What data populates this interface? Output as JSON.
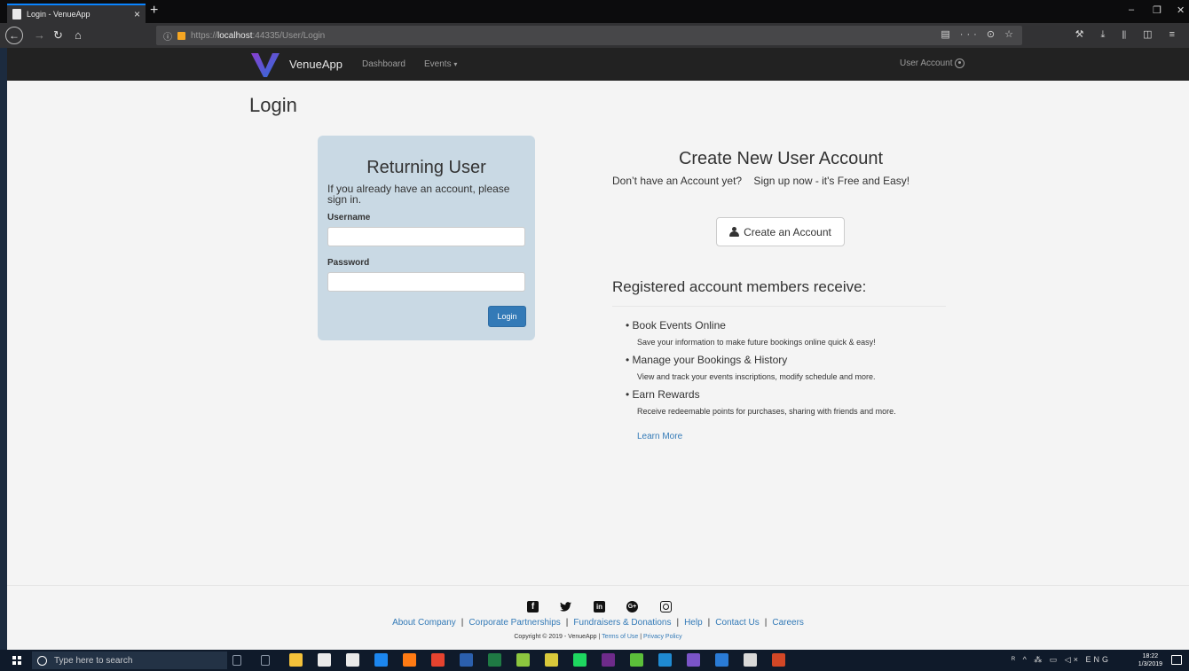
{
  "browser": {
    "tab_title": "Login - VenueApp",
    "tab_close": "×",
    "new_tab": "+",
    "url_info": "ⓘ",
    "url_scheme": "https://",
    "url_host": "localhost",
    "url_rest": ":44335/User/Login",
    "url_actions": "▤ ··· ⊙ ☆",
    "toolbar_icons": "⚒ ⤓ ⫴ ◫ ≡",
    "window_min": "–",
    "window_restore": "❐",
    "window_close": "✕",
    "back": "←",
    "forward": "→",
    "reload": "↻",
    "home": "⌂"
  },
  "site": {
    "brand": "VenueApp",
    "nav": [
      {
        "label": "Dashboard"
      },
      {
        "label": "Events"
      }
    ],
    "events_caret": "▾",
    "account_label": "User Account",
    "brand_colors": {
      "logo_start": "#7b3fd1",
      "logo_end": "#2a6fd8",
      "link": "#337ab7",
      "primary_button": "#337ab7",
      "panel_bg": "#c9d9e4"
    }
  },
  "page_title": "Login",
  "login": {
    "heading": "Returning User",
    "intro": "If you already have an account, please sign in.",
    "username_label": "Username",
    "username_value": "",
    "password_label": "Password",
    "password_value": "",
    "submit_label": "Login"
  },
  "register": {
    "heading": "Create New User Account",
    "subtext": "Don’t have an Account yet?    Sign up now - it's Free and Easy!",
    "button_label": "Create an Account",
    "benefits_heading": "Registered account members receive:",
    "benefits": [
      {
        "title": "• Book Events Online",
        "desc": "Save your information to make future bookings online quick & easy!"
      },
      {
        "title": "• Manage your Bookings & History",
        "desc": "View and track your events inscriptions, modify schedule and more."
      },
      {
        "title": "• Earn Rewards",
        "desc": "Receive redeemable points for purchases, sharing with friends and more."
      }
    ],
    "learn_more": "Learn More"
  },
  "footer": {
    "social": [
      {
        "name": "facebook-icon",
        "glyph": "f"
      },
      {
        "name": "twitter-icon",
        "glyph": "🐦"
      },
      {
        "name": "linkedin-icon",
        "glyph": "in"
      },
      {
        "name": "google-plus-icon",
        "glyph": "G+"
      },
      {
        "name": "instagram-icon",
        "glyph": ""
      }
    ],
    "links": [
      "About Company",
      "Corporate Partnerships",
      "Fundraisers & Donations",
      "Help",
      "Contact Us",
      "Careers"
    ],
    "separator": "|",
    "copyright": "Copyright © 2019 - VenueApp |",
    "terms": "Terms of Use",
    "privacy": "Privacy Policy"
  },
  "taskbar": {
    "search_placeholder": "Type here to search",
    "tray": "ᴿ ^ ⁂ ▭ ◁× ENG",
    "time": "18:22",
    "date": "1/3/2019",
    "apps": [
      {
        "name": "mic-icon",
        "color": "#0f1a2a"
      },
      {
        "name": "task-view-icon",
        "color": "#0f1a2a"
      },
      {
        "name": "file-explorer-icon",
        "color": "#f3c13a"
      },
      {
        "name": "store-icon",
        "color": "#eaeaea"
      },
      {
        "name": "mail-icon",
        "color": "#eaeaea"
      },
      {
        "name": "edge-icon",
        "color": "#1c86ee"
      },
      {
        "name": "firefox-icon",
        "color": "#ff7b14"
      },
      {
        "name": "chrome-icon",
        "color": "#e5432f"
      },
      {
        "name": "word-icon",
        "color": "#2b5fad"
      },
      {
        "name": "excel-icon",
        "color": "#1f7a44"
      },
      {
        "name": "notepadpp-icon",
        "color": "#8cc63f"
      },
      {
        "name": "gitkraken-icon",
        "color": "#d9c93b"
      },
      {
        "name": "spotify-icon",
        "color": "#1ed760"
      },
      {
        "name": "slack-icon",
        "color": "#6e2b8a"
      },
      {
        "name": "app-green-icon",
        "color": "#5bbf3a"
      },
      {
        "name": "vscode-icon",
        "color": "#1f8ad2"
      },
      {
        "name": "visual-studio-icon",
        "color": "#7a54c8"
      },
      {
        "name": "sourcetree-icon",
        "color": "#2a7bd6"
      },
      {
        "name": "github-desktop-icon",
        "color": "#d9d9d9"
      },
      {
        "name": "powerpoint-icon",
        "color": "#d24726"
      }
    ]
  }
}
